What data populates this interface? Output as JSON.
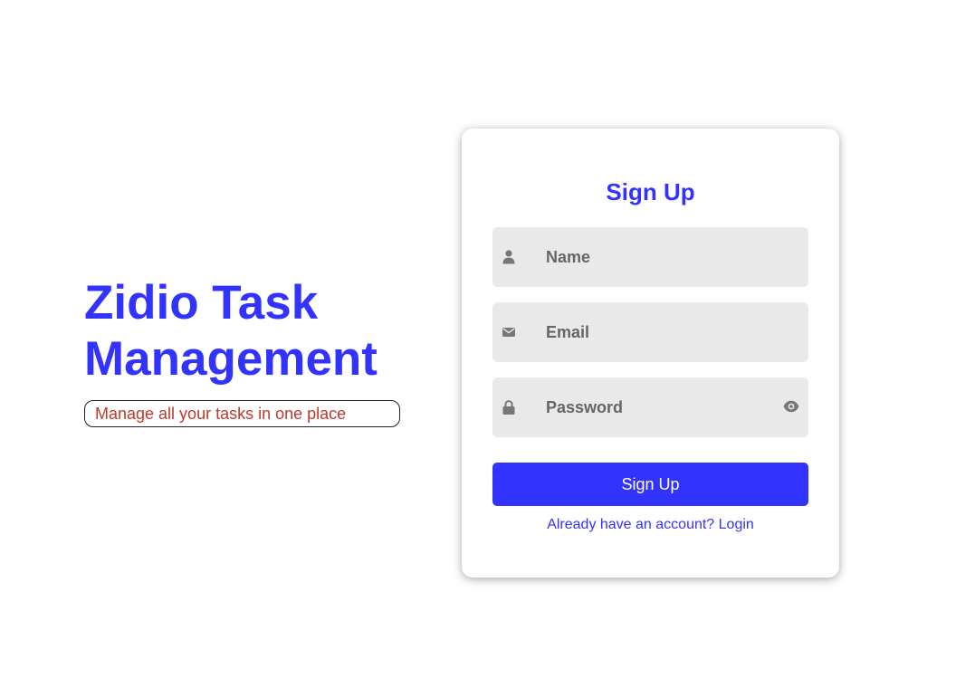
{
  "hero": {
    "title_line1": "Zidio Task",
    "title_line2": "Management",
    "tagline": "Manage all your tasks in one place"
  },
  "signup": {
    "heading": "Sign Up",
    "fields": {
      "name": {
        "placeholder": "Name",
        "icon": "user-icon"
      },
      "email": {
        "placeholder": "Email",
        "icon": "envelope-icon"
      },
      "password": {
        "placeholder": "Password",
        "icon": "lock-icon",
        "toggle_icon": "eye-icon"
      }
    },
    "submit_label": "Sign Up",
    "login_prompt": "Already have an account? ",
    "login_link": "Login"
  },
  "colors": {
    "accent": "#3333ff",
    "tagline": "#c0392b",
    "field_bg": "#e9e9e9",
    "icon": "#777777"
  }
}
